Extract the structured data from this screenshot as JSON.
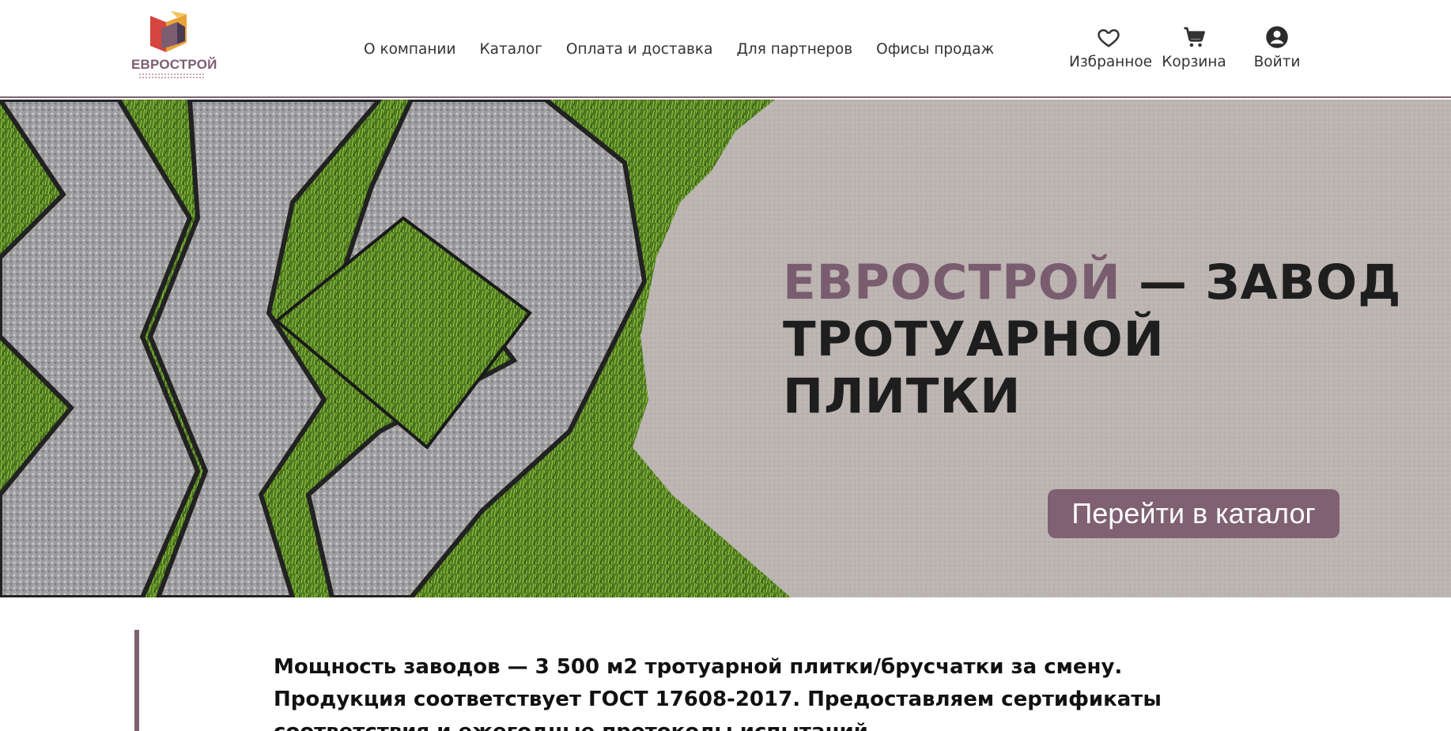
{
  "header": {
    "logo_text": "ЕВРОСТРОЙ",
    "nav": [
      {
        "label": "О компании"
      },
      {
        "label": "Каталог"
      },
      {
        "label": "Оплата и доставка"
      },
      {
        "label": "Для партнеров"
      },
      {
        "label": "Офисы продаж"
      }
    ],
    "actions": {
      "favorites": {
        "label": "Избранное",
        "icon": "heart-icon"
      },
      "cart": {
        "label": "Корзина",
        "icon": "cart-icon"
      },
      "login": {
        "label": "Войти",
        "icon": "user-icon"
      }
    }
  },
  "hero": {
    "brand": "ЕВРОСТРОЙ",
    "title_rest": " — ЗАВОД",
    "title_line2": "ТРОТУАРНОЙ ПЛИТКИ",
    "cta_label": "Перейти в каталог"
  },
  "info": {
    "text": "Мощность заводов — 3 500 м2 тротуарной плитки/брусчатки за смену. Продукция соответствует ГОСТ 17608-2017. Предоставляем сертификаты соответствия и ежегодные протоколы испытаний."
  },
  "colors": {
    "accent": "#7f6171",
    "brand_text": "#7a5c6f",
    "border": "#7a6170"
  }
}
